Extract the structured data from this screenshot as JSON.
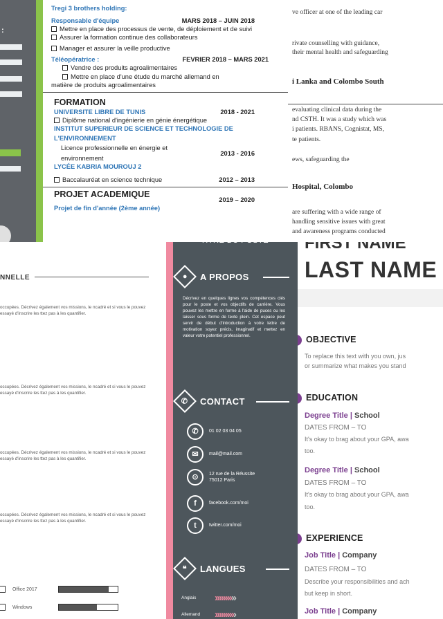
{
  "top_middle": {
    "company": "Tregi 3 brothers holding:",
    "job1": {
      "title": "Responsable d'équipe",
      "dates": "MARS 2018 – JUIN 2018"
    },
    "job1_items": [
      "Mettre en place des processus de vente, de déploiement et de suivi",
      "Assurer la formation continue des collaborateurs",
      "Manager et assurer la veille productive"
    ],
    "job2": {
      "title": "Téléopératrice :",
      "dates": "FEVRIER 2018 – MARS 2021"
    },
    "job2_items": [
      "Vendre des produits agroalimentaires",
      "Mettre en place d'une étude du marché allemand en",
      "matière de produits agroalimentaires"
    ],
    "formation_title": "FORMATION",
    "edu1": {
      "school": "UNIVERSITE LIBRE DE TUNIS",
      "dates": "2018 - 2021",
      "item": "Diplôme national d'ingénierie en génie énergétique"
    },
    "edu2": {
      "school_l1": "INSTITUT SUPERIEUR DE SCIENCE ET TECHNOLOGIE DE",
      "school_l2": "L'ENVIRONNEMENT",
      "item_l1": "Licence professionnelle en énergie et",
      "item_l2": "environnement",
      "dates": "2013 - 2016"
    },
    "edu3": {
      "school": "LYCÉE KABRIA MOUROUJ 2",
      "item": "Baccalauréat en science technique",
      "dates": "2012 – 2013"
    },
    "project_title": "PROJET ACADEMIQUE",
    "project_dates": "2019 – 2020",
    "project_sub": "Projet de fin d'année (2ème année)"
  },
  "top_right": {
    "p1": "ve officer at one of the leading car",
    "p2a": "rivate counselling with guidance,",
    "p2b": "their mental health and safeguarding",
    "h1": "i Lanka and Colombo South",
    "p3a": "evaluating clinical data during the",
    "p3b": "nd CSTH. It was a study which was",
    "p3c": "i patients. RBANS, Cognistat, MS,",
    "p3d": "te patients.",
    "p4": "ews, safeguarding the",
    "h2": "Hospital, Colombo",
    "p5a": "are suffering with a wide range of",
    "p5b": "handling sensitive issues with great",
    "p5c": "and awareness programs conducted"
  },
  "bottom_left": {
    "heading": "NNELLE",
    "para": "occupées. Décrivez également vos missions, le ncadré et si vous le pouvez essayé d'inscrire les ttez pas à les quantifier.",
    "skills": [
      {
        "label": "Office 2017",
        "level": 0.85
      },
      {
        "label": "Windows",
        "level": 0.65
      }
    ]
  },
  "sidebar": {
    "job_title": "TITRE DU POSTE",
    "apropos_title": "A PROPOS",
    "apropos_text": "Décrivez en quelques lignes vos compétences clés pour le poste et vos objectifs de carrière. Vous pouvez les mettre en forme à l'aide de puces ou les laisser sous forme de texte plein. Cet espace peut servir de début d'introduction à votre lettre de motivation soyez précis, imaginatif et mettez en valeur votre potentiel professionnel.",
    "contact_title": "CONTACT",
    "contact": {
      "phone": "01 02 03 04 05",
      "email": "mail@mail.com",
      "address1": "12 rue de la Réussite",
      "address2": "75012 Paris",
      "facebook": "facebook.com/moi",
      "twitter": "twitter.com/moi"
    },
    "langues_title": "LANGUES",
    "langues": [
      {
        "name": "Anglais",
        "level": 0.8
      },
      {
        "name": "Allemand",
        "level": 0.9
      }
    ]
  },
  "bottom_right": {
    "name_partial": "FIRST NAME",
    "last_name": "LAST NAME",
    "objective_title": "OBJECTIVE",
    "objective_l1": "To replace this text with you own, jus",
    "objective_l2": "or summarize what makes you stand",
    "education_title": "EDUCATION",
    "degree1": "Degree Title",
    "school1": "School",
    "dates1": "DATES FROM – TO",
    "edu_desc_l1": "It's okay to brag about your GPA, awa",
    "edu_desc_l2": "too.",
    "degree2": "Degree Title",
    "school2": "School",
    "dates2": "DATES FROM – TO",
    "edu_desc2_l1": "It's okay to brag about your GPA, awa",
    "edu_desc2_l2": "too.",
    "experience_title": "EXPERIENCE",
    "job1": "Job Title",
    "company1": "Company",
    "job_dates1": "DATES FROM – TO",
    "job_desc_l1": "Describe your responsibilities and ach",
    "job_desc_l2": "but keep in short.",
    "job2": "Job Title",
    "company2": "Company"
  },
  "colors": {
    "accent_green": "#8bc34a",
    "sidebar": "#4d565c",
    "pink": "#f08aa0",
    "purple": "#7b3f8f",
    "blue": "#2e75b6"
  }
}
